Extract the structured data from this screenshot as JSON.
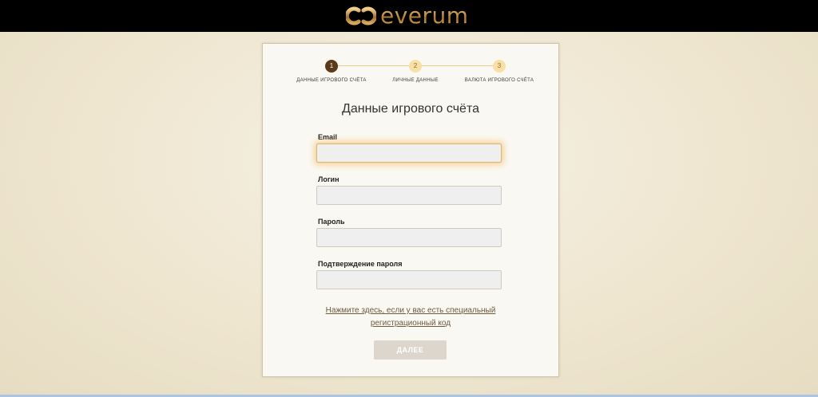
{
  "header": {
    "logo_text": "everum",
    "logo_icon": "everum-logo-icon"
  },
  "steps": [
    {
      "number": "1",
      "label": "ДАННЫЕ ИГРОВОГО СЧЁТА",
      "state": "active"
    },
    {
      "number": "2",
      "label": "ЛИЧНЫЕ ДАННЫЕ",
      "state": "pending"
    },
    {
      "number": "3",
      "label": "ВАЛЮТА ИГРОВОГО СЧЁТА",
      "state": "pending"
    }
  ],
  "form": {
    "title": "Данные игрового счёта",
    "fields": [
      {
        "label": "Email",
        "value": ""
      },
      {
        "label": "Логин",
        "value": ""
      },
      {
        "label": "Пароль",
        "value": ""
      },
      {
        "label": "Подтверждение пароля",
        "value": ""
      }
    ],
    "reg_code_link_line1": "Нажмите здесь, если у вас есть специальный",
    "reg_code_link_line2": "регистрационный код",
    "next_button": "ДАЛЕЕ"
  },
  "colors": {
    "accent_gold": "#c49a55",
    "active_step": "#5a3a1a",
    "pending_step": "#f8dfa6",
    "button_disabled": "#dcd6cc"
  }
}
